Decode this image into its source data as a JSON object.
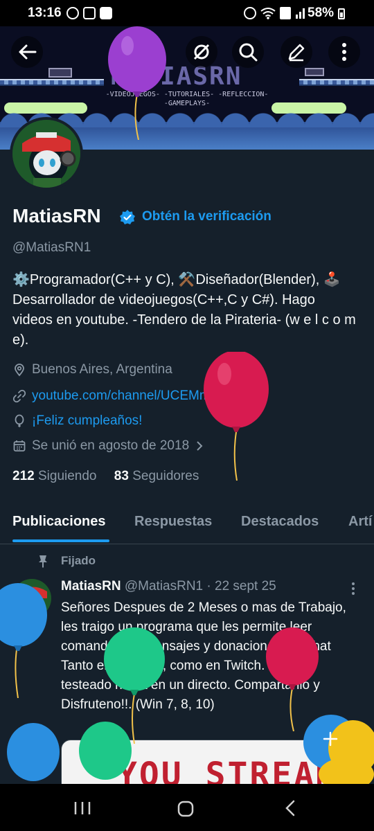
{
  "status_bar": {
    "time": "13:16",
    "battery_percent": "58%",
    "left_icons": [
      "whatsapp-icon",
      "instagram-icon",
      "youtube-icon"
    ],
    "right_icons": [
      "alarm-icon",
      "wifi-icon",
      "volte-icon",
      "signal-icon",
      "battery-icon"
    ]
  },
  "banner": {
    "title": "MATIASRN",
    "subtitle": "-VIDEOJUEGOS- -TUTORIALES- -REFLECCION- -GAMEPLAYS-"
  },
  "header_icons": [
    "back-arrow-icon",
    "grok-icon",
    "search-icon",
    "edit-icon",
    "more-vertical-icon"
  ],
  "profile": {
    "name": "MatiasRN",
    "verify_label": "Obtén la verificación",
    "handle": "@MatiasRN1",
    "bio": "⚙️Programador(C++ y C), ⚒️Diseñador(Blender), 🕹️ Desarrollador de videojuegos(C++,C y C#). Hago videos en youtube. -Tendero de la Pirateria- (w e l c o m e).",
    "location": "Buenos Aires, Argentina",
    "website": "youtube.com/channel/UCEMm4...",
    "birthday": "¡Feliz cumpleaños!",
    "joined": "Se unió en agosto de 2018",
    "following_count": "212",
    "following_label": "Siguiendo",
    "followers_count": "83",
    "followers_label": "Seguidores"
  },
  "tabs": [
    "Publicaciones",
    "Respuestas",
    "Destacados",
    "Artí"
  ],
  "post": {
    "pinned_label": "Fijado",
    "author": "MatiasRN",
    "handle": "@MatiasRN1",
    "date": "· 22 sept 25",
    "text": "Señores Despues de 2 Meses o mas de Trabajo, les traigo un programa que les permite leer comandos en mensajes y donaciones del chat Tanto en Youtube, como en Twitch. Ya esta testeado hasta en un directo. Compartanlo y Disfruteno!!. (Win 7, 8, 10)",
    "media_text": "YOU STREAM"
  },
  "fab_icon": "plus-icon",
  "android_nav": [
    "recent-apps-icon",
    "home-icon",
    "back-icon"
  ],
  "colors": {
    "background": "#15202b",
    "accent": "#1d9bf0",
    "muted": "#8b98a5",
    "balloon_purple": "#9b3fd0",
    "balloon_red": "#d81b50",
    "balloon_blue": "#2b8fe0",
    "balloon_green": "#1ec889",
    "balloon_yellow": "#f2c21a"
  }
}
